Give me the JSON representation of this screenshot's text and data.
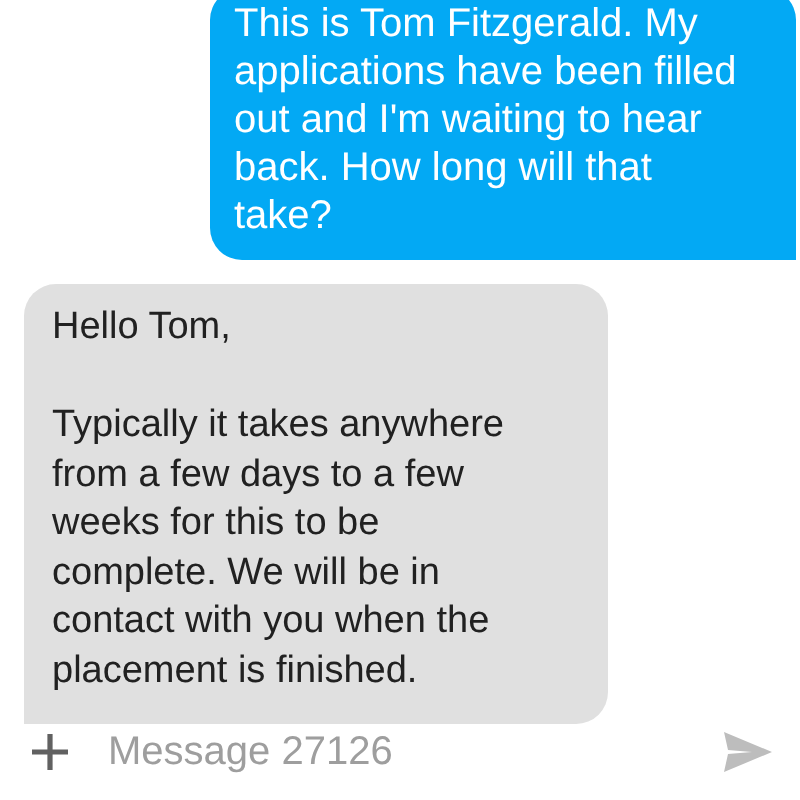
{
  "messages": [
    {
      "kind": "sent",
      "text": "This is Tom Fitzgerald. My applications have been filled out and I'm waiting to hear back. How long will that take?"
    },
    {
      "kind": "received",
      "text": "Hello Tom,\n\nTypically it takes anywhere from a few days to a few weeks for this to be complete. We will be in contact with you when the placement is finished."
    }
  ],
  "composer": {
    "placeholder": "Message 27126"
  }
}
